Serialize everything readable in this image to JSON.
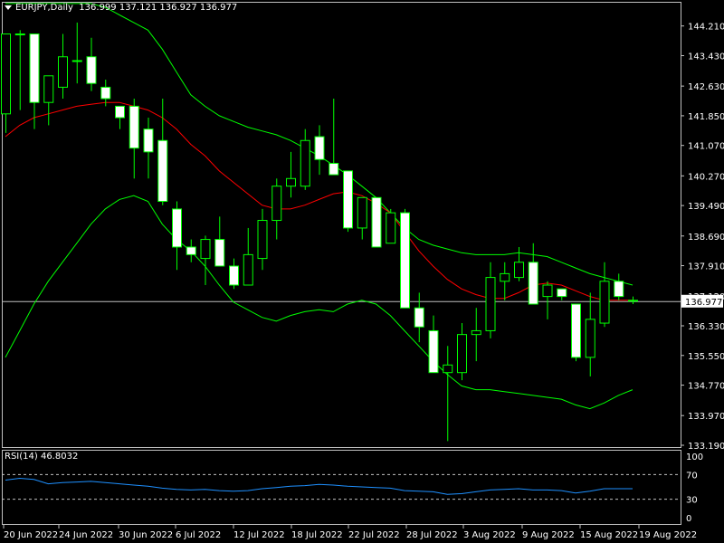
{
  "header": {
    "symbol_label": "EURJPY,Daily",
    "ohlc_text": "136.999 137.121 136.927 136.977"
  },
  "rsi": {
    "label": "RSI(14) 46.8032",
    "axis_labels": [
      "100",
      "70",
      "30",
      "0"
    ],
    "levels": [
      70,
      30
    ]
  },
  "price_axis": {
    "ticks": [
      "144.210",
      "143.430",
      "142.630",
      "141.850",
      "141.070",
      "140.270",
      "139.490",
      "138.690",
      "137.910",
      "137.120",
      "136.330",
      "135.550",
      "134.770",
      "133.970",
      "133.190"
    ],
    "current_price": "136.977"
  },
  "date_axis": {
    "ticks": [
      "20 Jun 2022",
      "24 Jun 2022",
      "30 Jun 2022",
      "6 Jul 2022",
      "12 Jul 2022",
      "18 Jul 2022",
      "22 Jul 2022",
      "28 Jul 2022",
      "3 Aug 2022",
      "9 Aug 2022",
      "15 Aug 2022",
      "19 Aug 2022"
    ]
  },
  "colors": {
    "background": "#000000",
    "bull": "#00ff00",
    "bear": "#ffffff",
    "ma": "#ff0000",
    "bands": "#00ff00",
    "rsi": "#1e90ff",
    "grid": "#c0c0c0",
    "price_line": "#c0c0c0"
  },
  "chart_data": {
    "type": "candlestick",
    "symbol": "EURJPY",
    "timeframe": "Daily",
    "ylim": [
      133.19,
      144.75
    ],
    "candles": [
      {
        "o": 141.9,
        "h": 144.0,
        "l": 141.4,
        "c": 144.0
      },
      {
        "o": 144.0,
        "h": 144.1,
        "l": 142.0,
        "c": 144.0
      },
      {
        "o": 144.0,
        "h": 144.0,
        "l": 141.5,
        "c": 142.2
      },
      {
        "o": 142.2,
        "h": 142.8,
        "l": 141.6,
        "c": 142.9
      },
      {
        "o": 142.6,
        "h": 144.0,
        "l": 142.3,
        "c": 143.4
      },
      {
        "o": 143.3,
        "h": 144.3,
        "l": 142.7,
        "c": 143.3
      },
      {
        "o": 143.4,
        "h": 143.9,
        "l": 142.5,
        "c": 142.7
      },
      {
        "o": 142.6,
        "h": 142.8,
        "l": 142.1,
        "c": 142.3
      },
      {
        "o": 142.1,
        "h": 142.1,
        "l": 141.5,
        "c": 141.8
      },
      {
        "o": 142.1,
        "h": 142.3,
        "l": 140.2,
        "c": 141.0
      },
      {
        "o": 141.5,
        "h": 141.8,
        "l": 140.2,
        "c": 140.9
      },
      {
        "o": 141.2,
        "h": 142.3,
        "l": 139.5,
        "c": 139.6
      },
      {
        "o": 139.4,
        "h": 139.6,
        "l": 137.8,
        "c": 138.4
      },
      {
        "o": 138.4,
        "h": 138.6,
        "l": 138.0,
        "c": 138.2
      },
      {
        "o": 138.1,
        "h": 138.7,
        "l": 137.4,
        "c": 138.6
      },
      {
        "o": 138.6,
        "h": 139.2,
        "l": 137.9,
        "c": 137.9
      },
      {
        "o": 137.9,
        "h": 138.1,
        "l": 137.3,
        "c": 137.4
      },
      {
        "o": 137.4,
        "h": 138.9,
        "l": 137.4,
        "c": 138.2
      },
      {
        "o": 138.1,
        "h": 139.4,
        "l": 137.8,
        "c": 139.1
      },
      {
        "o": 139.1,
        "h": 140.2,
        "l": 138.6,
        "c": 140.0
      },
      {
        "o": 140.0,
        "h": 140.9,
        "l": 139.7,
        "c": 140.2
      },
      {
        "o": 140.0,
        "h": 141.5,
        "l": 139.9,
        "c": 141.2
      },
      {
        "o": 141.3,
        "h": 141.6,
        "l": 140.3,
        "c": 140.7
      },
      {
        "o": 140.6,
        "h": 142.3,
        "l": 140.3,
        "c": 140.3
      },
      {
        "o": 140.4,
        "h": 140.4,
        "l": 138.8,
        "c": 138.9
      },
      {
        "o": 138.9,
        "h": 139.7,
        "l": 138.6,
        "c": 139.7
      },
      {
        "o": 139.7,
        "h": 139.7,
        "l": 138.4,
        "c": 138.4
      },
      {
        "o": 138.5,
        "h": 139.4,
        "l": 138.5,
        "c": 139.3
      },
      {
        "o": 139.3,
        "h": 139.4,
        "l": 136.8,
        "c": 136.8
      },
      {
        "o": 136.8,
        "h": 137.2,
        "l": 135.9,
        "c": 136.3
      },
      {
        "o": 136.2,
        "h": 136.6,
        "l": 135.1,
        "c": 135.1
      },
      {
        "o": 135.1,
        "h": 135.8,
        "l": 133.3,
        "c": 135.3
      },
      {
        "o": 135.1,
        "h": 136.4,
        "l": 134.9,
        "c": 136.1
      },
      {
        "o": 136.1,
        "h": 136.8,
        "l": 135.4,
        "c": 136.2
      },
      {
        "o": 136.2,
        "h": 138.0,
        "l": 136.0,
        "c": 137.6
      },
      {
        "o": 137.5,
        "h": 138.0,
        "l": 137.0,
        "c": 137.7
      },
      {
        "o": 137.6,
        "h": 138.4,
        "l": 137.5,
        "c": 138.0
      },
      {
        "o": 138.0,
        "h": 138.5,
        "l": 136.9,
        "c": 136.9
      },
      {
        "o": 137.1,
        "h": 137.5,
        "l": 136.5,
        "c": 137.4
      },
      {
        "o": 137.3,
        "h": 137.3,
        "l": 137.0,
        "c": 137.1
      },
      {
        "o": 136.9,
        "h": 136.9,
        "l": 135.4,
        "c": 135.5
      },
      {
        "o": 135.5,
        "h": 137.2,
        "l": 135.0,
        "c": 136.5
      },
      {
        "o": 136.4,
        "h": 138.0,
        "l": 136.3,
        "c": 137.5
      },
      {
        "o": 137.5,
        "h": 137.7,
        "l": 137.0,
        "c": 137.1
      },
      {
        "o": 137.0,
        "h": 137.1,
        "l": 136.9,
        "c": 136.98
      }
    ],
    "moving_average": [
      141.3,
      141.6,
      141.8,
      141.9,
      142.0,
      142.1,
      142.15,
      142.2,
      142.2,
      142.1,
      142.0,
      141.8,
      141.5,
      141.1,
      140.8,
      140.4,
      140.1,
      139.8,
      139.5,
      139.4,
      139.4,
      139.5,
      139.65,
      139.8,
      139.85,
      139.75,
      139.55,
      139.3,
      138.8,
      138.3,
      137.9,
      137.55,
      137.3,
      137.15,
      137.05,
      137.05,
      137.2,
      137.4,
      137.45,
      137.4,
      137.25,
      137.1,
      137.0,
      137.0,
      137.0
    ],
    "bands_upper": [
      144.8,
      144.8,
      144.8,
      144.8,
      144.8,
      144.8,
      144.8,
      144.7,
      144.5,
      144.3,
      144.1,
      143.6,
      143.0,
      142.4,
      142.1,
      141.85,
      141.7,
      141.55,
      141.45,
      141.35,
      141.2,
      141.0,
      140.8,
      140.55,
      140.3,
      140.0,
      139.7,
      139.3,
      138.9,
      138.6,
      138.45,
      138.35,
      138.25,
      138.2,
      138.2,
      138.2,
      138.25,
      138.2,
      138.15,
      138.0,
      137.85,
      137.7,
      137.6,
      137.5,
      137.4
    ],
    "bands_lower": [
      135.5,
      136.2,
      136.9,
      137.5,
      138.0,
      138.5,
      139.0,
      139.4,
      139.65,
      139.75,
      139.6,
      139.0,
      138.6,
      138.3,
      137.9,
      137.4,
      136.95,
      136.75,
      136.55,
      136.45,
      136.6,
      136.7,
      136.75,
      136.7,
      136.9,
      137.0,
      136.9,
      136.6,
      136.2,
      135.8,
      135.4,
      135.05,
      134.75,
      134.65,
      134.65,
      134.6,
      134.55,
      134.5,
      134.45,
      134.4,
      134.25,
      134.15,
      134.3,
      134.5,
      134.65
    ],
    "rsi_values": [
      61,
      64,
      62,
      55,
      57,
      58,
      59,
      57,
      55,
      53,
      51,
      48,
      46,
      45,
      46,
      44,
      43,
      44,
      47,
      49,
      51,
      52,
      54,
      53,
      51,
      50,
      49,
      48,
      44,
      43,
      42,
      38,
      39,
      42,
      45,
      46,
      47,
      45,
      45,
      44,
      40,
      43,
      47,
      47,
      47
    ]
  }
}
